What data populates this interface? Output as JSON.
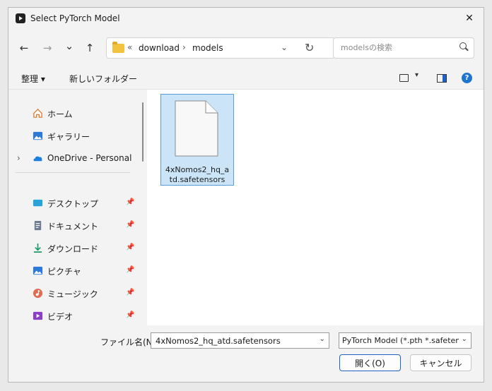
{
  "window": {
    "title": "Select PyTorch Model",
    "close_label": "✕"
  },
  "nav": {
    "back": "←",
    "forward": "→",
    "recent": "⌄",
    "up": "↑",
    "breadcrumbs_prefix": "«",
    "breadcrumbs": [
      "download",
      "models"
    ],
    "breadcrumb_sep": "›",
    "address_dropdown": "⌄",
    "refresh": "↻",
    "search_placeholder": "modelsの検索"
  },
  "toolbar": {
    "organize_label": "整理 ▾",
    "new_folder_label": "新しいフォルダー",
    "view_dropdown": "▾",
    "help": "?"
  },
  "sidebar": {
    "items": [
      {
        "label": "ホーム",
        "icon": "home-icon",
        "pinned": false
      },
      {
        "label": "ギャラリー",
        "icon": "gallery-icon",
        "pinned": false
      },
      {
        "label": "OneDrive - Personal",
        "icon": "onedrive-icon",
        "pinned": false,
        "expander": "›"
      },
      {
        "label": "デスクトップ",
        "icon": "desktop-icon",
        "pinned": true
      },
      {
        "label": "ドキュメント",
        "icon": "documents-icon",
        "pinned": true
      },
      {
        "label": "ダウンロード",
        "icon": "downloads-icon",
        "pinned": true
      },
      {
        "label": "ピクチャ",
        "icon": "pictures-icon",
        "pinned": true
      },
      {
        "label": "ミュージック",
        "icon": "music-icon",
        "pinned": true
      },
      {
        "label": "ビデオ",
        "icon": "videos-icon",
        "pinned": true
      }
    ],
    "pin_glyph": "📌"
  },
  "files": [
    {
      "name": "4xNomos2_hq_atd.safetensors",
      "selected": true
    }
  ],
  "footer": {
    "filename_label": "ファイル名(N):",
    "filename_value": "4xNomos2_hq_atd.safetensors",
    "filetype_value": "PyTorch Model (*.pth *.safetensors)",
    "dropdown": "⌄",
    "open_label": "開く(O)",
    "cancel_label": "キャンセル"
  },
  "colors": {
    "accent": "#1f62c7",
    "selection": "#cce4f7"
  }
}
